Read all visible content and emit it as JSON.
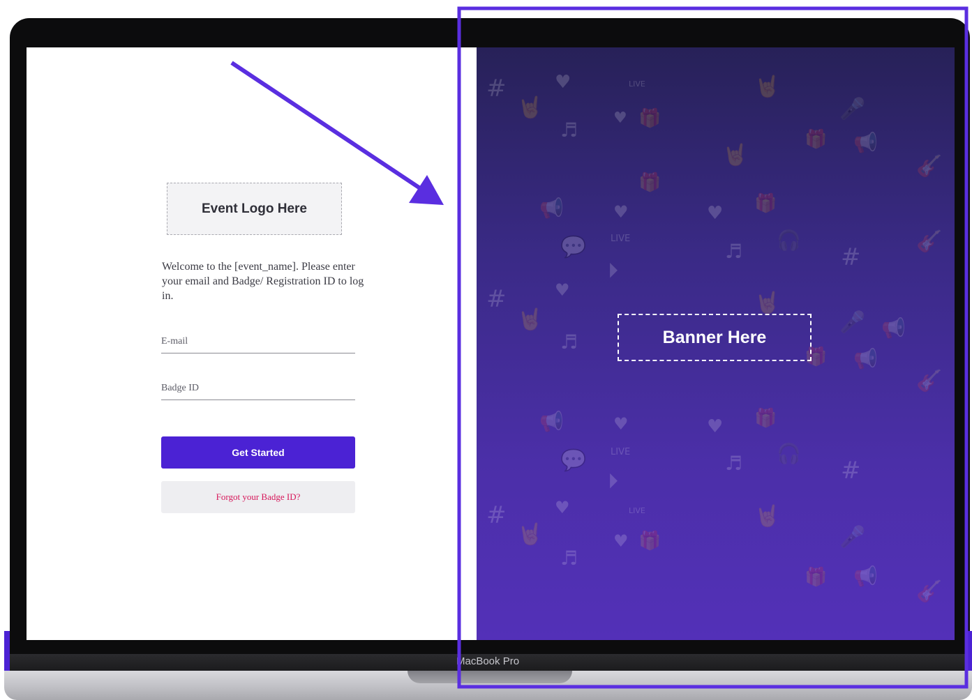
{
  "login": {
    "logo_placeholder": "Event Logo Here",
    "welcome_message": "Welcome to the [event_name]. Please enter your email and Badge/ Registration ID to log in.",
    "email_placeholder": "E-mail",
    "badge_placeholder": "Badge ID",
    "primary_button": "Get Started",
    "forgot_link": "Forgot your Badge ID?"
  },
  "banner": {
    "placeholder": "Banner Here"
  },
  "device": {
    "model_label": "MacBook Pro"
  },
  "colors": {
    "brand_purple": "#4b22d4",
    "forgot_link": "#d6175a",
    "banner_top": "#272158",
    "banner_bottom": "#5330b8",
    "annotation": "#5a2ee0"
  },
  "pattern_icons": [
    "hash-icon",
    "heart-icon",
    "music-note-icon",
    "megaphone-icon",
    "live-icon",
    "chat-bubble-icon",
    "play-icon",
    "headphones-icon",
    "microphone-icon",
    "gift-icon",
    "rock-hand-icon",
    "guitar-icon"
  ]
}
